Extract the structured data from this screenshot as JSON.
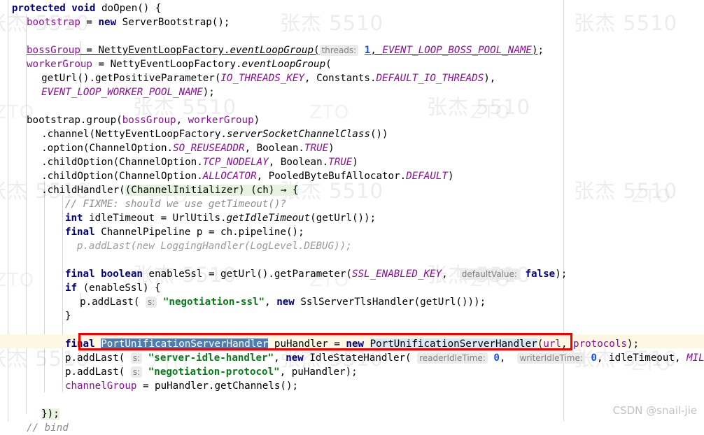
{
  "app": {
    "kind": "code-editor",
    "language": "Java",
    "theme": "IntelliJ Light"
  },
  "annotation": {
    "type": "red-rectangle",
    "color": "#f20000",
    "target_line": 22
  },
  "attribution": {
    "csdn": "CSDN @snail-jie"
  },
  "watermarks": {
    "name": "张杰 5510",
    "company": "ZTO"
  },
  "colors": {
    "background": "#ffffff",
    "keyword": "#000080",
    "field": "#871094",
    "string": "#067D17",
    "number": "#1750EB",
    "comment": "#8C8C8C",
    "inlay_hint_bg": "#ebebeb",
    "inlay_hint_fg": "#808080",
    "selection_bg": "#4d7daf",
    "caret_row_bg": "#fdf6e3",
    "identifier_highlight": "#dbe9f7",
    "block_highlight": "#e8f2e0",
    "annotation_red": "#f20000"
  },
  "code": {
    "lines": [
      {
        "n": 1,
        "indent": 2.0,
        "segments": [
          {
            "t": "protected void ",
            "c": "kw"
          },
          {
            "t": "doOpen",
            "c": "plain"
          },
          {
            "t": "() {",
            "c": "plain"
          }
        ]
      },
      {
        "n": 2,
        "indent": 4.5,
        "segments": [
          {
            "t": "bootstrap",
            "c": "field"
          },
          {
            "t": " = ",
            "c": "plain"
          },
          {
            "t": "new",
            "c": "kw"
          },
          {
            "t": " ServerBootstrap();",
            "c": "plain"
          }
        ]
      },
      {
        "n": 3,
        "indent": 0,
        "segments": []
      },
      {
        "n": 4,
        "indent": 4.5,
        "segments": [
          {
            "t": "bossGroup",
            "c": "field ulink"
          },
          {
            "t": " = ",
            "c": "plain ulink"
          },
          {
            "t": "NettyEventLoopFactory.",
            "c": "plain ulink"
          },
          {
            "t": "eventLoopGroup",
            "c": "statfn ulink"
          },
          {
            "t": "(",
            "c": "plain ulink"
          },
          {
            "t": "threads:",
            "c": "hint"
          },
          {
            "t": " ",
            "c": "plain"
          },
          {
            "t": "1",
            "c": "num ulink"
          },
          {
            "t": ", ",
            "c": "plain ulink"
          },
          {
            "t": "EVENT_LOOP_BOSS_POOL_NAME",
            "c": "fielditl ulink"
          },
          {
            "t": ")",
            "c": "plain ulink"
          },
          {
            "t": ";",
            "c": "plain"
          }
        ]
      },
      {
        "n": 5,
        "indent": 4.5,
        "segments": [
          {
            "t": "workerGroup",
            "c": "field"
          },
          {
            "t": " = NettyEventLoopFactory.",
            "c": "plain"
          },
          {
            "t": "eventLoopGroup",
            "c": "statfn"
          },
          {
            "t": "(",
            "c": "plain"
          }
        ]
      },
      {
        "n": 6,
        "indent": 7.0,
        "segments": [
          {
            "t": "getUrl().getPositiveParameter(",
            "c": "plain"
          },
          {
            "t": "IO_THREADS_KEY",
            "c": "fielditl"
          },
          {
            "t": ", Constants.",
            "c": "plain"
          },
          {
            "t": "DEFAULT_IO_THREADS",
            "c": "fielditl"
          },
          {
            "t": "),",
            "c": "plain"
          }
        ]
      },
      {
        "n": 7,
        "indent": 7.0,
        "segments": [
          {
            "t": "EVENT_LOOP_WORKER_POOL_NAME",
            "c": "fielditl"
          },
          {
            "t": ");",
            "c": "plain"
          }
        ]
      },
      {
        "n": 8,
        "indent": 0,
        "segments": []
      },
      {
        "n": 9,
        "indent": 4.5,
        "segments": [
          {
            "t": "bootstrap.group(",
            "c": "plain"
          },
          {
            "t": "bossGroup",
            "c": "field"
          },
          {
            "t": ", ",
            "c": "plain"
          },
          {
            "t": "workerGroup",
            "c": "field"
          },
          {
            "t": ")",
            "c": "plain"
          }
        ]
      },
      {
        "n": 10,
        "indent": 7.0,
        "segments": [
          {
            "t": ".channel(NettyEventLoopFactory.",
            "c": "plain"
          },
          {
            "t": "serverSocketChannelClass",
            "c": "statfn"
          },
          {
            "t": "())",
            "c": "plain"
          }
        ]
      },
      {
        "n": 11,
        "indent": 7.0,
        "segments": [
          {
            "t": ".option(ChannelOption.",
            "c": "plain"
          },
          {
            "t": "SO_REUSEADDR",
            "c": "fielditl"
          },
          {
            "t": ", Boolean.",
            "c": "plain"
          },
          {
            "t": "TRUE",
            "c": "fielditl"
          },
          {
            "t": ")",
            "c": "plain"
          }
        ]
      },
      {
        "n": 12,
        "indent": 7.0,
        "segments": [
          {
            "t": ".childOption(ChannelOption.",
            "c": "plain"
          },
          {
            "t": "TCP_NODELAY",
            "c": "fielditl"
          },
          {
            "t": ", Boolean.",
            "c": "plain"
          },
          {
            "t": "TRUE",
            "c": "fielditl"
          },
          {
            "t": ")",
            "c": "plain"
          }
        ]
      },
      {
        "n": 13,
        "indent": 7.0,
        "segments": [
          {
            "t": ".childOption(ChannelOption.",
            "c": "plain"
          },
          {
            "t": "ALLOCATOR",
            "c": "fielditl"
          },
          {
            "t": ", PooledByteBufAllocator.",
            "c": "plain"
          },
          {
            "t": "DEFAULT",
            "c": "fielditl"
          },
          {
            "t": ")",
            "c": "plain"
          }
        ]
      },
      {
        "n": 14,
        "indent": 7.0,
        "segments": [
          {
            "t": ".childHandler(",
            "c": "plain"
          },
          {
            "t": "(ChannelInitializer) (ch) → {",
            "c": "plain blk-hl"
          }
        ]
      },
      {
        "n": 15,
        "indent": 11.0,
        "segments": [
          {
            "t": "// FIXME: should we use getTimeout()?",
            "c": "cmt"
          }
        ]
      },
      {
        "n": 16,
        "indent": 11.0,
        "segments": [
          {
            "t": "int",
            "c": "kw"
          },
          {
            "t": " idleTimeout = UrlUtils.",
            "c": "plain"
          },
          {
            "t": "getIdleTimeout",
            "c": "statfn"
          },
          {
            "t": "(getUrl());",
            "c": "plain"
          }
        ]
      },
      {
        "n": 17,
        "indent": 11.0,
        "segments": [
          {
            "t": "final",
            "c": "kw"
          },
          {
            "t": " ChannelPipeline p = ch.pipeline();",
            "c": "plain"
          }
        ]
      },
      {
        "n": 18,
        "indent": 13.0,
        "segments": [
          {
            "t": "p.addLast(new LoggingHandler(LogLevel.DEBUG));",
            "c": "dim"
          }
        ]
      },
      {
        "n": 19,
        "indent": 0,
        "segments": []
      },
      {
        "n": 20,
        "indent": 11.0,
        "segments": [
          {
            "t": "final boolean",
            "c": "kw"
          },
          {
            "t": " enableSsl = getUrl().getParameter(",
            "c": "plain"
          },
          {
            "t": "SSL_ENABLED_KEY",
            "c": "fielditl"
          },
          {
            "t": ",  ",
            "c": "plain"
          },
          {
            "t": "defaultValue:",
            "c": "hint"
          },
          {
            "t": " ",
            "c": "plain"
          },
          {
            "t": "false",
            "c": "kw"
          },
          {
            "t": ");",
            "c": "plain"
          }
        ]
      },
      {
        "n": 21,
        "indent": 11.0,
        "segments": [
          {
            "t": "if",
            "c": "kw"
          },
          {
            "t": " (enableSsl) {",
            "c": "plain"
          }
        ]
      },
      {
        "n": 22,
        "indent": 13.5,
        "segments": [
          {
            "t": "p.addLast( ",
            "c": "plain"
          },
          {
            "t": "s:",
            "c": "hint"
          },
          {
            "t": " ",
            "c": "plain"
          },
          {
            "t": "\"negotiation-ssl\"",
            "c": "str"
          },
          {
            "t": ", ",
            "c": "plain"
          },
          {
            "t": "new",
            "c": "kw"
          },
          {
            "t": " SslServerTlsHandler(getUrl()));",
            "c": "plain"
          }
        ]
      },
      {
        "n": 23,
        "indent": 11.0,
        "segments": [
          {
            "t": "}",
            "c": "plain"
          }
        ]
      },
      {
        "n": 24,
        "indent": 0,
        "segments": []
      },
      {
        "n": 25,
        "indent": 11.0,
        "highlight_row": true,
        "boxed": true,
        "segments": [
          {
            "t": "final",
            "c": "kw"
          },
          {
            "t": " ",
            "c": "plain"
          },
          {
            "t": "PortUnificationServerHandler",
            "c": "sel"
          },
          {
            "t": " puHandler = ",
            "c": "plain"
          },
          {
            "t": "new",
            "c": "kw"
          },
          {
            "t": " ",
            "c": "plain"
          },
          {
            "t": "PortUnificationServerHandler",
            "c": "plain ident-hl"
          },
          {
            "t": "(",
            "c": "plain"
          },
          {
            "t": "url",
            "c": "field"
          },
          {
            "t": ", ",
            "c": "plain"
          },
          {
            "t": "protocols",
            "c": "field"
          },
          {
            "t": ");",
            "c": "plain"
          }
        ]
      },
      {
        "n": 26,
        "indent": 11.0,
        "segments": [
          {
            "t": "p.addLast( ",
            "c": "plain"
          },
          {
            "t": "s:",
            "c": "hint"
          },
          {
            "t": " ",
            "c": "plain"
          },
          {
            "t": "\"server-idle-handler\"",
            "c": "str"
          },
          {
            "t": ", ",
            "c": "plain"
          },
          {
            "t": "new",
            "c": "kw"
          },
          {
            "t": " IdleStateHandler( ",
            "c": "plain"
          },
          {
            "t": "readerIdleTime:",
            "c": "hint"
          },
          {
            "t": " ",
            "c": "plain"
          },
          {
            "t": "0",
            "c": "num"
          },
          {
            "t": ",  ",
            "c": "plain"
          },
          {
            "t": "writerIdleTime:",
            "c": "hint"
          },
          {
            "t": " ",
            "c": "plain"
          },
          {
            "t": "0",
            "c": "num"
          },
          {
            "t": ", idleTimeout, ",
            "c": "plain"
          },
          {
            "t": "MILLISECONDS",
            "c": "fielditl"
          },
          {
            "t": "));",
            "c": "plain"
          }
        ]
      },
      {
        "n": 27,
        "indent": 11.0,
        "segments": [
          {
            "t": "p.addLast( ",
            "c": "plain"
          },
          {
            "t": "s:",
            "c": "hint"
          },
          {
            "t": " ",
            "c": "plain"
          },
          {
            "t": "\"negotiation-protocol\"",
            "c": "str"
          },
          {
            "t": ", puHandler);",
            "c": "plain"
          }
        ]
      },
      {
        "n": 28,
        "indent": 11.0,
        "segments": [
          {
            "t": "channelGroup",
            "c": "field"
          },
          {
            "t": " = puHandler.getChannels();",
            "c": "plain"
          }
        ]
      },
      {
        "n": 29,
        "indent": 0,
        "segments": []
      },
      {
        "n": 30,
        "indent": 7.0,
        "segments": [
          {
            "t": "});",
            "c": "plain blk-hl"
          }
        ]
      },
      {
        "n": 31,
        "indent": 4.5,
        "segments": [
          {
            "t": "// bind",
            "c": "cmt"
          }
        ]
      }
    ]
  }
}
